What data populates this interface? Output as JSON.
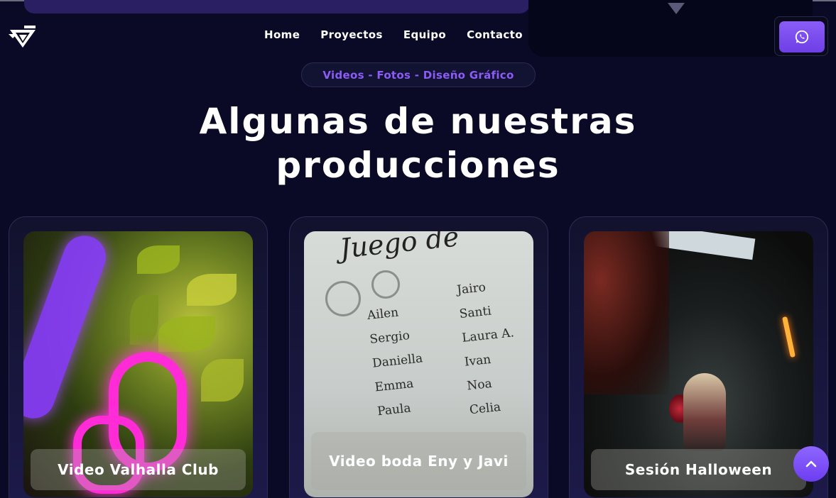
{
  "header": {
    "nav": [
      "Home",
      "Proyectos",
      "Equipo",
      "Contacto"
    ],
    "whatsapp_icon": "whatsapp-icon",
    "logo_icon": "g-logo-icon"
  },
  "hero": {
    "pill_text": "Videos - Fotos - Diseño Gráfico",
    "heading_line1": "Algunas de nuestras",
    "heading_line2": "producciones"
  },
  "cards": [
    {
      "title": "Video Valhalla Club"
    },
    {
      "title": "Video boda Eny y Javi"
    },
    {
      "title": "Sesión Halloween"
    }
  ],
  "paper": {
    "title": "Juego de",
    "names_left": [
      "Ailen",
      "Sergio",
      "Daniella",
      "Emma",
      "Paula"
    ],
    "names_right": [
      "Jairo",
      "Santi",
      "Laura A.",
      "Ivan",
      "Noa",
      "Celia"
    ]
  },
  "colors": {
    "accent": "#8b5cf6",
    "background": "#0a0a26"
  },
  "scroll_top_icon": "chevron-up-icon"
}
